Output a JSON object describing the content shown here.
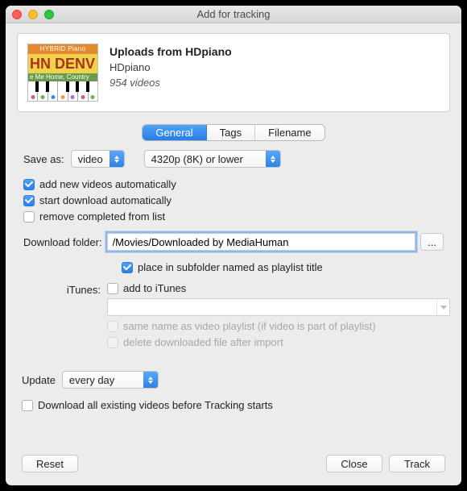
{
  "window": {
    "title": "Add for tracking"
  },
  "thumb": {
    "band1": "HYBRID Piano Lesson",
    "band2": "HN DENV",
    "band3": "e Me Home, Country Ro"
  },
  "info": {
    "title": "Uploads from HDpiano",
    "channel": "HDpiano",
    "count": "954 videos"
  },
  "tabs": {
    "general": "General",
    "tags": "Tags",
    "filename": "Filename"
  },
  "saveas": {
    "label": "Save as:",
    "format": "video",
    "quality": "4320p (8K) or lower"
  },
  "checks": {
    "add_auto": "add new videos automatically",
    "start_auto": "start download automatically",
    "remove_done": "remove completed from list",
    "subfolder": "place in subfolder named as playlist title",
    "add_itunes": "add to iTunes",
    "same_name": "same name as video playlist (if video is part of playlist)",
    "delete_after": "delete downloaded file after import",
    "dl_existing": "Download all existing videos before Tracking starts"
  },
  "folder": {
    "label": "Download folder:",
    "value": "/Movies/Downloaded by MediaHuman",
    "browse": "..."
  },
  "itunes": {
    "label": "iTunes:",
    "playlist": ""
  },
  "update": {
    "label": "Update",
    "value": "every day"
  },
  "buttons": {
    "reset": "Reset",
    "close": "Close",
    "track": "Track"
  }
}
